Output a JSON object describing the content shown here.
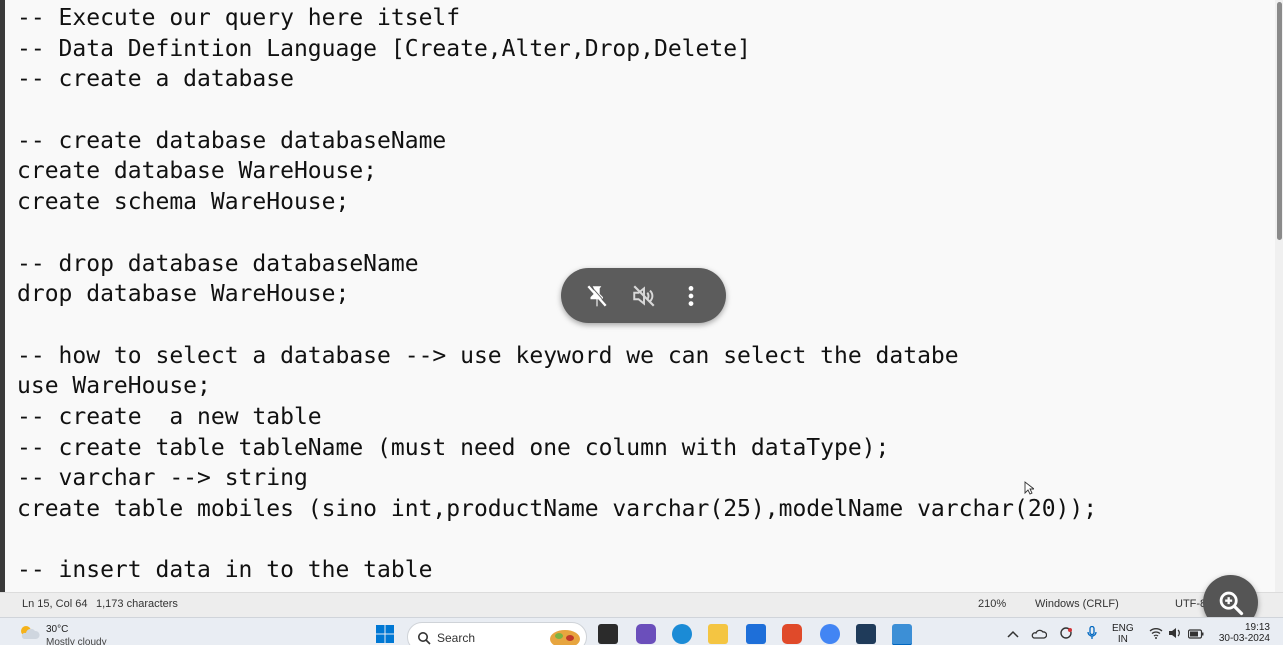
{
  "editor": {
    "lines": [
      "-- Execute our query here itself",
      "-- Data Defintion Language [Create,Alter,Drop,Delete]",
      "-- create a database",
      "",
      "-- create database databaseName",
      "create database WareHouse;",
      "create schema WareHouse;",
      "",
      "-- drop database databaseName",
      "drop database WareHouse;",
      "",
      "-- how to select a database --> use keyword we can select the databe",
      "use WareHouse;",
      "-- create  a new table",
      "-- create table tableName (must need one column with dataType);",
      "-- varchar --> string",
      "create table mobiles (sino int,productName varchar(25),modelName varchar(20));",
      "",
      "-- insert data in to the table"
    ]
  },
  "media_controls": {
    "icons": [
      "pin-off-icon",
      "muted-speaker-icon",
      "more-vertical-icon"
    ]
  },
  "statusbar": {
    "position": "Ln 15, Col 64",
    "characters": "1,173 characters",
    "zoom": "210%",
    "line_ending": "Windows (CRLF)",
    "encoding": "UTF-8"
  },
  "taskbar": {
    "weather_temp": "30°C",
    "weather_desc": "Mostly cloudy",
    "search_label": "Search",
    "language_top": "ENG",
    "language_bottom": "IN",
    "time": "19:13",
    "date": "30-03-2024"
  },
  "colors": {
    "editor_bg": "#f9f9f9",
    "text": "#111111",
    "pill_bg": "#5c5c5c",
    "taskbar_bg": "#e9edf3"
  }
}
